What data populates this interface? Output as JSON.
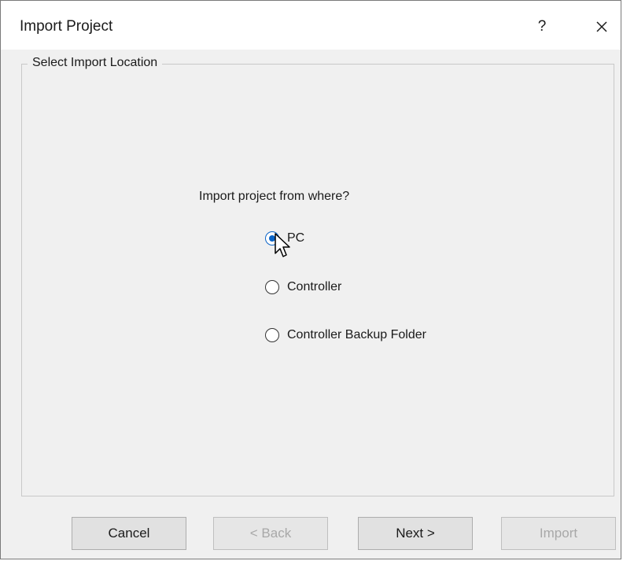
{
  "window": {
    "title": "Import Project",
    "help_label": "?"
  },
  "group": {
    "label": "Select Import Location"
  },
  "question": "Import project from where?",
  "options": [
    {
      "label": "PC",
      "selected": true
    },
    {
      "label": "Controller",
      "selected": false
    },
    {
      "label": "Controller Backup Folder",
      "selected": false
    }
  ],
  "buttons": {
    "cancel": "Cancel",
    "back": "< Back",
    "next": "Next >",
    "import": "Import"
  },
  "colors": {
    "accent": "#0a64c8",
    "dialog_bg": "#f0f0f0"
  }
}
